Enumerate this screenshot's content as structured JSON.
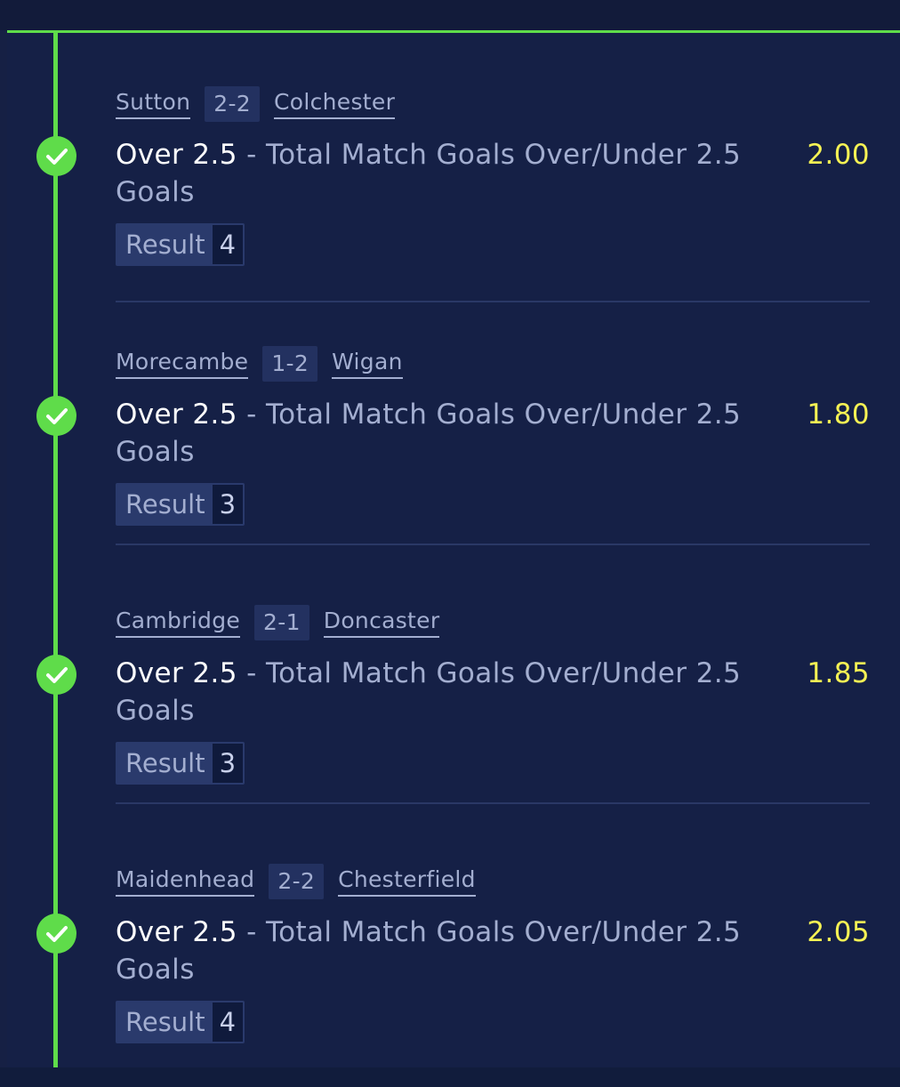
{
  "colors": {
    "accent_green": "#5fdc4a",
    "odds_yellow": "#f6f254",
    "background": "#152046",
    "muted_text": "#a3aed0"
  },
  "legs": [
    {
      "home": "Sutton",
      "score": "2-2",
      "away": "Colchester",
      "selection": "Over 2.5",
      "market": " - Total Match Goals Over/Under 2.5 Goals",
      "odds": "2.00",
      "result_label": "Result",
      "result_value": "4",
      "status_icon": "check-icon"
    },
    {
      "home": "Morecambe",
      "score": "1-2",
      "away": "Wigan",
      "selection": "Over 2.5",
      "market": " - Total Match Goals Over/Under 2.5 Goals",
      "odds": "1.80",
      "result_label": "Result",
      "result_value": "3",
      "status_icon": "check-icon"
    },
    {
      "home": "Cambridge",
      "score": "2-1",
      "away": "Doncaster",
      "selection": "Over 2.5",
      "market": " - Total Match Goals Over/Under 2.5 Goals",
      "odds": "1.85",
      "result_label": "Result",
      "result_value": "3",
      "status_icon": "check-icon"
    },
    {
      "home": "Maidenhead",
      "score": "2-2",
      "away": "Chesterfield",
      "selection": "Over 2.5",
      "market": " - Total Match Goals Over/Under 2.5 Goals",
      "odds": "2.05",
      "result_label": "Result",
      "result_value": "4",
      "status_icon": "check-icon"
    }
  ]
}
